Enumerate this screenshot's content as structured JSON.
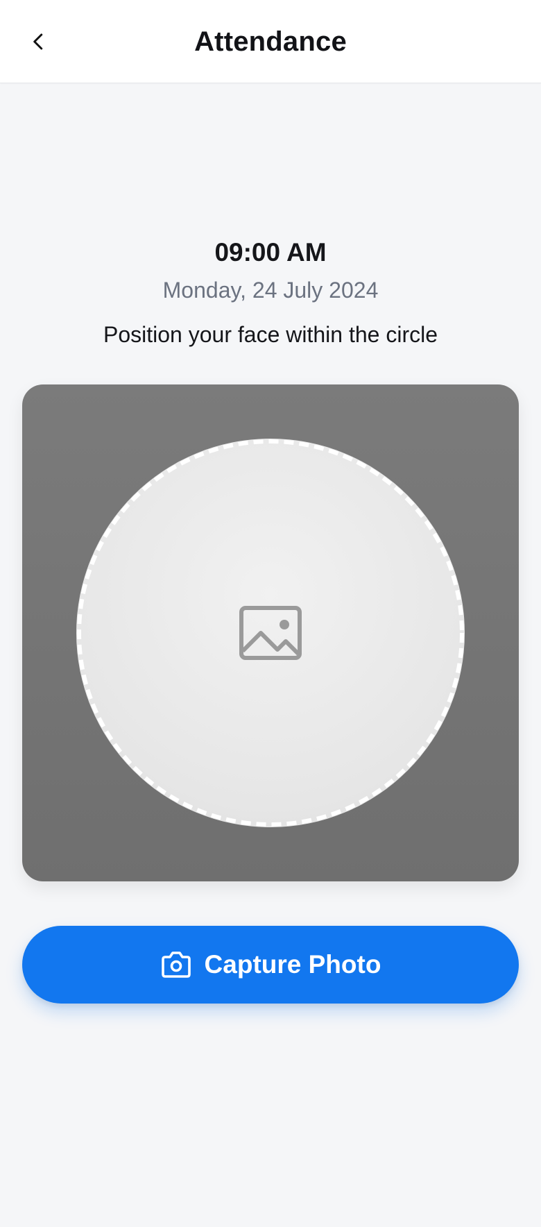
{
  "header": {
    "title": "Attendance",
    "back_icon": "chevron-left-icon"
  },
  "clock": {
    "time": "09:00 AM",
    "date": "Monday, 24 July 2024"
  },
  "instruction": "Position your face within the circle",
  "camera": {
    "placeholder_icon": "image-placeholder-icon"
  },
  "capture": {
    "label": "Capture Photo",
    "icon": "camera-icon",
    "color": "#1277ef"
  }
}
